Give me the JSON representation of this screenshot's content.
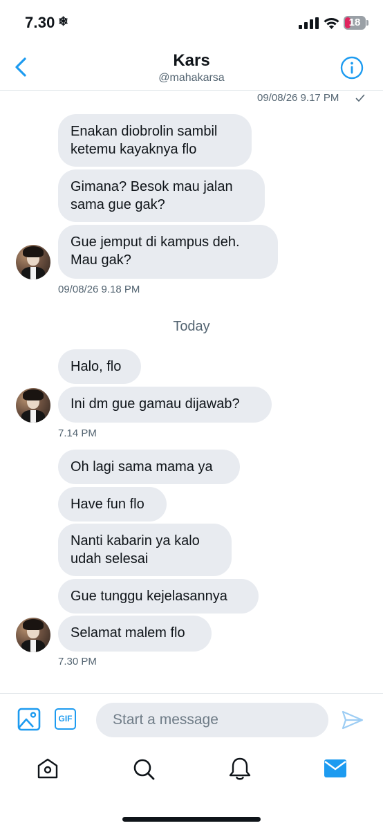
{
  "status": {
    "time": "7.30",
    "battery": "18"
  },
  "header": {
    "name": "Kars",
    "handle": "@mahakarsa"
  },
  "top_timestamp": "09/08/26 9.17 PM",
  "groups": [
    {
      "messages": [
        "Enakan diobrolin sambil\nketemu kayaknya flo",
        "Gimana? Besok mau jalan\nsama gue gak?",
        "Gue jemput di kampus deh.\nMau gak?"
      ],
      "time": "09/08/26 9.18 PM"
    },
    {
      "messages": [
        "Halo, flo",
        "Ini dm gue gamau dijawab?"
      ],
      "time": "7.14 PM"
    },
    {
      "messages": [
        "Oh lagi sama mama ya",
        "Have fun flo",
        "Nanti kabarin ya kalo\nudah selesai",
        "Gue tunggu kejelasannya",
        "Selamat malem flo"
      ],
      "time": "7.30 PM"
    }
  ],
  "day_separator": "Today",
  "composer": {
    "placeholder": "Start a message",
    "gif_label": "GIF"
  },
  "colors": {
    "accent": "#1d9bf0",
    "bubble": "#e8ebf0",
    "muted": "#536471"
  }
}
